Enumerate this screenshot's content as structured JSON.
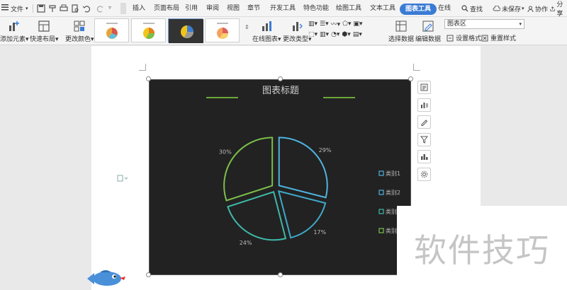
{
  "menubar": {
    "file_label": "文件",
    "tabs": [
      {
        "label": "插入"
      },
      {
        "label": "页面布局"
      },
      {
        "label": "引用"
      },
      {
        "label": "审阅"
      },
      {
        "label": "视图"
      },
      {
        "label": "章节"
      },
      {
        "label": "开发工具"
      },
      {
        "label": "特色功能"
      },
      {
        "label": "绘图工具"
      },
      {
        "label": "文本工具"
      },
      {
        "label": "图表工具"
      },
      {
        "label": "在线"
      }
    ],
    "active_tab_color": "#3a7bd5",
    "search_label": "查找",
    "unsaved_label": "未保存",
    "collab_label": "协作",
    "share_label": "分享"
  },
  "ribbon": {
    "add_element": "添加元素",
    "quick_layout": "快速布局",
    "change_color": "更改颜色",
    "online_chart": "在线图表",
    "change_type": "更改类型",
    "select_data": "选择数据",
    "edit_data": "编辑数据",
    "chart_area_select": "图表区",
    "set_format": "设置格式",
    "reset_style": "重置样式"
  },
  "chart": {
    "title": "图表标题",
    "background": "#222222",
    "legend": [
      {
        "label": "类别1",
        "color": "#4fb3e0"
      },
      {
        "label": "类别2",
        "color": "#4fb3e0"
      },
      {
        "label": "类别",
        "color": "#3fb8a8"
      },
      {
        "label": "类别",
        "color": "#7bbf4a"
      }
    ]
  },
  "chart_data": {
    "type": "pie",
    "title": "图表标题",
    "categories": [
      "类别1",
      "类别2",
      "类别3",
      "类别4"
    ],
    "values": [
      29,
      17,
      24,
      30
    ],
    "data_labels": [
      "29%",
      "17%",
      "24%",
      "30%"
    ],
    "colors": [
      "#4fb3e0",
      "#3fa8c8",
      "#3fb8a8",
      "#7bbf4a"
    ],
    "style": "exploded-outline",
    "legend_position": "right"
  },
  "watermark": {
    "text": "软件技巧"
  }
}
